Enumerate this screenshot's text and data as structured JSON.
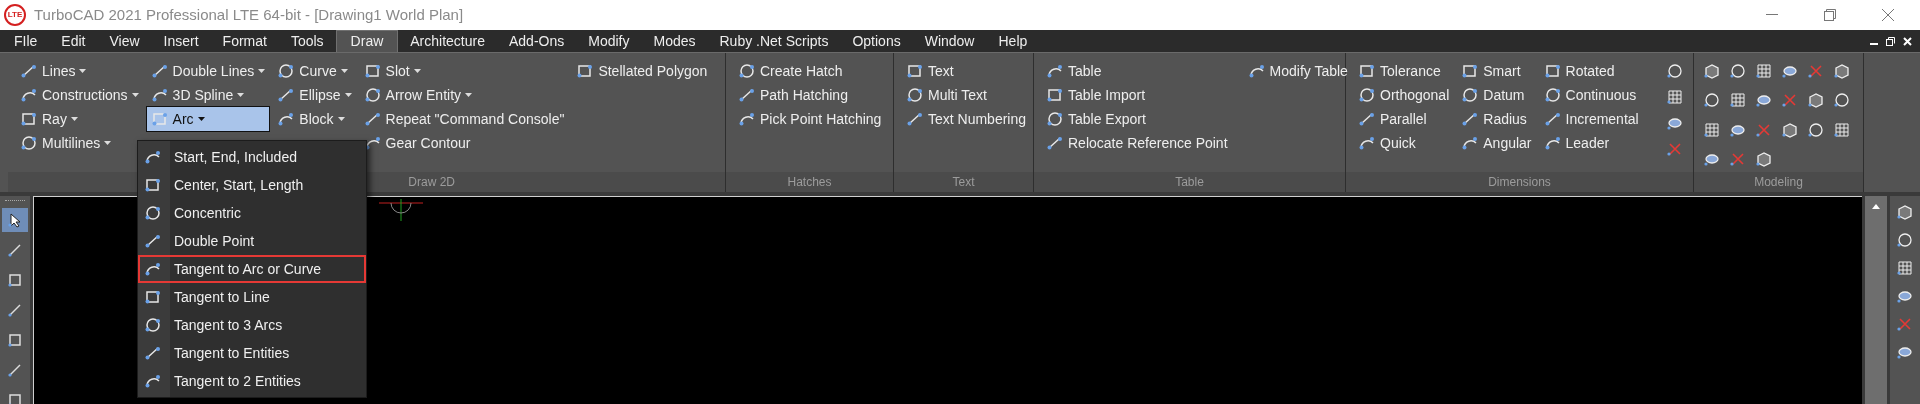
{
  "window": {
    "title": "TurboCAD 2021 Professional LTE 64-bit - [Drawing1 World Plan]",
    "logo": "LTE"
  },
  "menu_bar": [
    {
      "label": "FIle",
      "selected": false
    },
    {
      "label": "Edit",
      "selected": false
    },
    {
      "label": "View",
      "selected": false
    },
    {
      "label": "Insert",
      "selected": false
    },
    {
      "label": "Format",
      "selected": false
    },
    {
      "label": "Tools",
      "selected": false
    },
    {
      "label": "Draw",
      "selected": true
    },
    {
      "label": "Architecture",
      "selected": false
    },
    {
      "label": "Add-Ons",
      "selected": false
    },
    {
      "label": "Modify",
      "selected": false
    },
    {
      "label": "Modes",
      "selected": false
    },
    {
      "label": "Ruby .Net Scripts",
      "selected": false
    },
    {
      "label": "Options",
      "selected": false
    },
    {
      "label": "Window",
      "selected": false
    },
    {
      "label": "Help",
      "selected": false
    }
  ],
  "ribbon": [
    {
      "label": "Draw 2D",
      "columns": [
        [
          {
            "label": "Lines",
            "dropdown": true,
            "selected": false
          },
          {
            "label": "Constructions",
            "dropdown": true,
            "selected": false
          },
          {
            "label": "Ray",
            "dropdown": true,
            "selected": false
          },
          {
            "label": "Multilines",
            "dropdown": true,
            "selected": false
          }
        ],
        [
          {
            "label": "Double Lines",
            "dropdown": true,
            "selected": false
          },
          {
            "label": "3D Spline",
            "dropdown": true,
            "selected": false
          },
          {
            "label": "Arc",
            "dropdown": true,
            "selected": true
          }
        ],
        [
          {
            "label": "Curve",
            "dropdown": true,
            "selected": false
          },
          {
            "label": "Ellipse",
            "dropdown": true,
            "selected": false
          },
          {
            "label": "Block",
            "dropdown": true,
            "selected": false
          }
        ],
        [
          {
            "label": "Slot",
            "dropdown": true,
            "selected": false
          },
          {
            "label": "Arrow Entity",
            "dropdown": true,
            "selected": false
          },
          {
            "label": "Repeat \"Command Console\"",
            "dropdown": false,
            "selected": false
          },
          {
            "label": "Gear Contour",
            "dropdown": false,
            "selected": false
          }
        ],
        [
          {
            "label": "Stellated Polygon",
            "dropdown": false,
            "selected": false
          }
        ]
      ]
    },
    {
      "label": "Hatches",
      "columns": [
        [
          {
            "label": "Create Hatch",
            "dropdown": false,
            "selected": false
          },
          {
            "label": "Path Hatching",
            "dropdown": false,
            "selected": false
          },
          {
            "label": "Pick Point Hatching",
            "dropdown": false,
            "selected": false
          }
        ]
      ]
    },
    {
      "label": "Text",
      "columns": [
        [
          {
            "label": "Text",
            "dropdown": false,
            "selected": false
          },
          {
            "label": "Multi Text",
            "dropdown": false,
            "selected": false
          },
          {
            "label": "Text Numbering",
            "dropdown": false,
            "selected": false
          }
        ]
      ]
    },
    {
      "label": "Table",
      "columns": [
        [
          {
            "label": "Table",
            "dropdown": false,
            "selected": false
          },
          {
            "label": "Table Import",
            "dropdown": false,
            "selected": false
          },
          {
            "label": "Table Export",
            "dropdown": false,
            "selected": false
          },
          {
            "label": "Relocate Reference Point",
            "dropdown": false,
            "selected": false
          }
        ],
        [
          {
            "label": "Modify Table",
            "dropdown": false,
            "selected": false
          }
        ]
      ]
    },
    {
      "label": "Dimensions",
      "columns": [
        [
          {
            "label": "Tolerance",
            "dropdown": false,
            "selected": false
          },
          {
            "label": "Orthogonal",
            "dropdown": false,
            "selected": false
          },
          {
            "label": "Parallel",
            "dropdown": false,
            "selected": false
          },
          {
            "label": "Quick",
            "dropdown": false,
            "selected": false
          }
        ],
        [
          {
            "label": "Smart",
            "dropdown": false,
            "selected": false
          },
          {
            "label": "Datum",
            "dropdown": false,
            "selected": false
          },
          {
            "label": "Radius",
            "dropdown": false,
            "selected": false
          },
          {
            "label": "Angular",
            "dropdown": false,
            "selected": false
          }
        ],
        [
          {
            "label": "Rotated",
            "dropdown": false,
            "selected": false
          },
          {
            "label": "Continuous",
            "dropdown": false,
            "selected": false
          },
          {
            "label": "Incremental",
            "dropdown": false,
            "selected": false
          },
          {
            "label": "Leader",
            "dropdown": false,
            "selected": false
          }
        ]
      ]
    },
    {
      "label": "Modeling"
    }
  ],
  "arc_menu": [
    {
      "label": "Start, End, Included",
      "selected": false
    },
    {
      "label": "Center, Start, Length",
      "selected": false
    },
    {
      "label": "Concentric",
      "selected": false
    },
    {
      "label": "Double Point",
      "selected": false
    },
    {
      "label": "Tangent to Arc or Curve",
      "selected": true
    },
    {
      "label": "Tangent to Line",
      "selected": false
    },
    {
      "label": "Tangent to 3 Arcs",
      "selected": false
    },
    {
      "label": "Tangent to Entities",
      "selected": false
    },
    {
      "label": "Tangent to 2 Entities",
      "selected": false
    }
  ],
  "left_toolbar": [
    {
      "selected": true
    },
    {
      "selected": false
    },
    {
      "selected": false
    },
    {
      "selected": false
    },
    {
      "selected": false
    },
    {
      "selected": false
    },
    {
      "selected": false
    }
  ]
}
